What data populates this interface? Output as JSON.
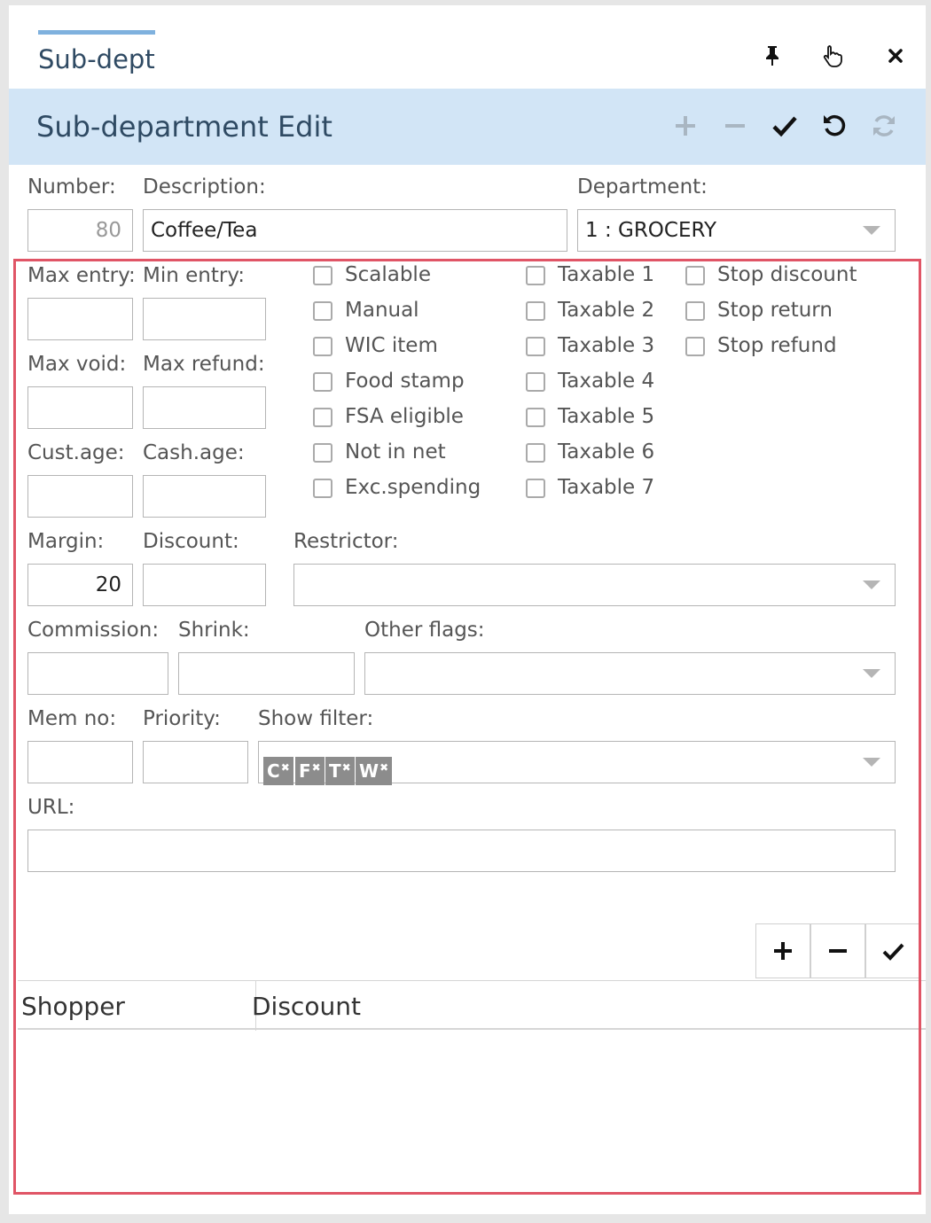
{
  "tab": {
    "title": "Sub-dept"
  },
  "toolbar": {
    "title": "Sub-department Edit"
  },
  "labels": {
    "number": "Number:",
    "description": "Description:",
    "department": "Department:",
    "max_entry": "Max entry:",
    "min_entry": "Min entry:",
    "max_void": "Max void:",
    "max_refund": "Max refund:",
    "cust_age": "Cust.age:",
    "cash_age": "Cash.age:",
    "margin": "Margin:",
    "discount": "Discount:",
    "restrictor": "Restrictor:",
    "commission": "Commission:",
    "shrink": "Shrink:",
    "other_flags": "Other flags:",
    "mem_no": "Mem no:",
    "priority": "Priority:",
    "show_filter": "Show filter:",
    "url": "URL:"
  },
  "values": {
    "number": "80",
    "description": "Coffee/Tea",
    "department": "1 : GROCERY",
    "margin": "20"
  },
  "checkboxes": {
    "col1": [
      "Scalable",
      "Manual",
      "WIC item",
      "Food stamp",
      "FSA eligible",
      "Not in net",
      "Exc.spending"
    ],
    "col2": [
      "Taxable 1",
      "Taxable 2",
      "Taxable 3",
      "Taxable 4",
      "Taxable 5",
      "Taxable 6",
      "Taxable 7"
    ],
    "col3": [
      "Stop discount",
      "Stop return",
      "Stop refund"
    ]
  },
  "filter_chips": [
    "C",
    "F",
    "T",
    "W"
  ],
  "grid": {
    "columns": [
      "Shopper",
      "Discount"
    ]
  },
  "icons": {
    "tab": [
      "pin-icon",
      "pointer-icon",
      "close-icon"
    ],
    "toolbar": [
      "add-icon",
      "remove-icon",
      "check-icon",
      "undo-icon",
      "refresh-icon"
    ],
    "grid": [
      "add-icon",
      "remove-icon",
      "check-icon"
    ]
  },
  "colors": {
    "toolbar_bg": "#d2e5f6",
    "accent": "#7fb1de",
    "highlight": "#e05566",
    "chip": "#8c8c8c"
  }
}
